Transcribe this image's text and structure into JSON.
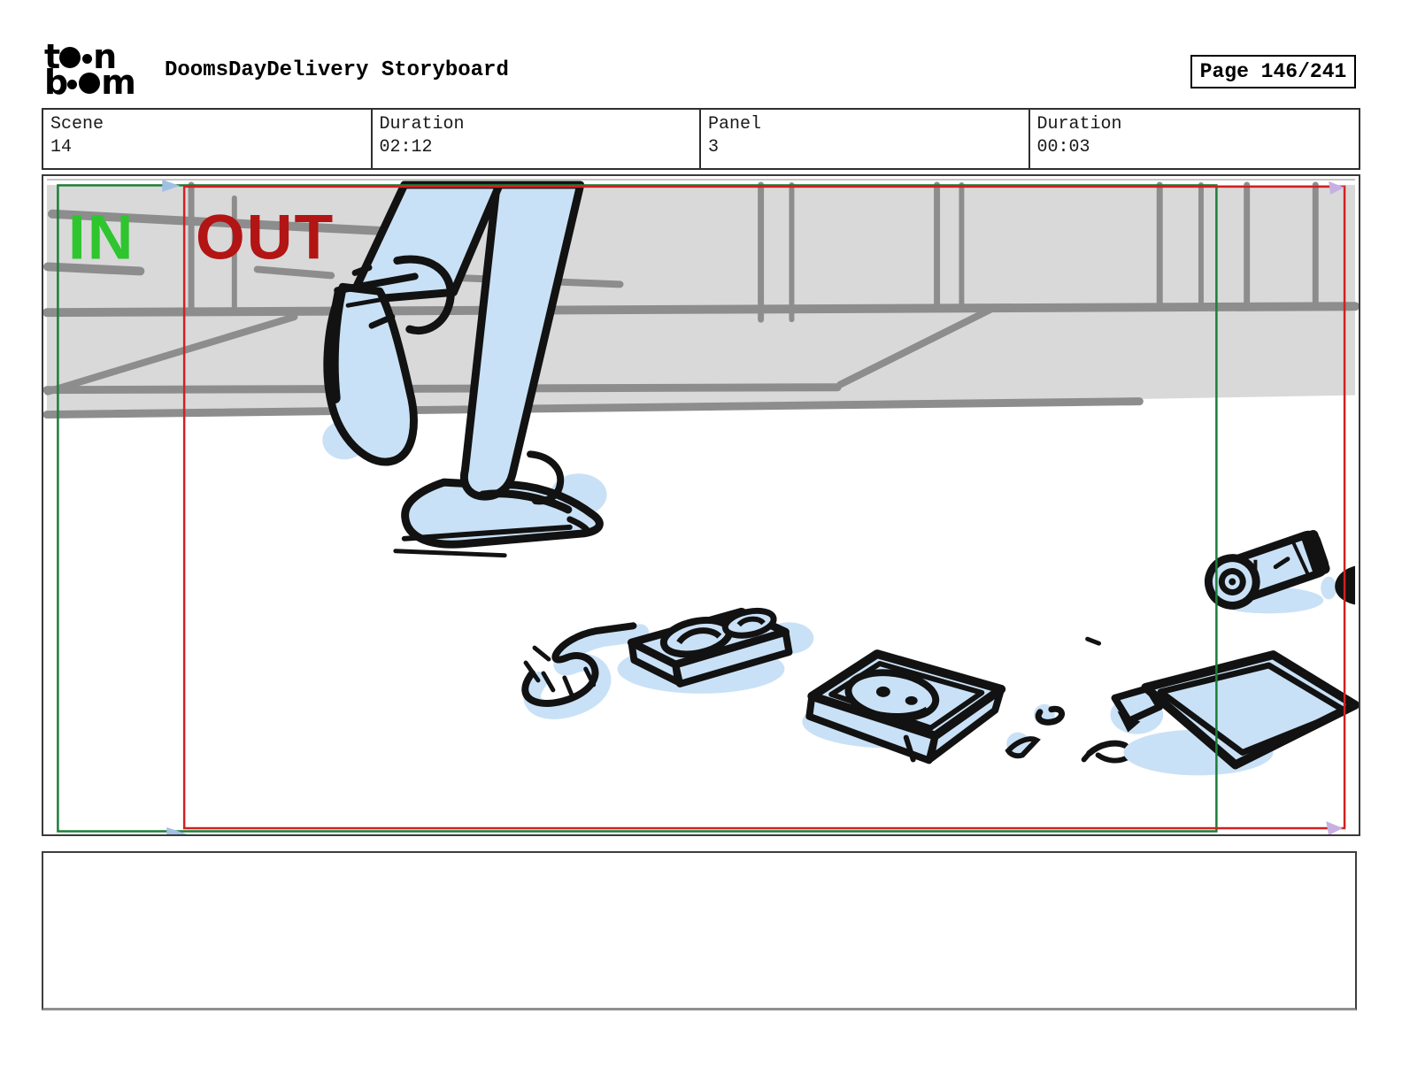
{
  "header": {
    "brand": {
      "alt": "toon boom",
      "row1_left": "t",
      "row1_right": "n",
      "row2_left": "b",
      "row2_right": "m"
    },
    "title": "DoomsDayDelivery Storyboard",
    "page_label": "Page 146/241"
  },
  "info": {
    "cells": [
      {
        "label": "Scene",
        "value": "14"
      },
      {
        "label": "Duration",
        "value": "02:12"
      },
      {
        "label": "Panel",
        "value": "3"
      },
      {
        "label": "Duration",
        "value": "00:03"
      }
    ]
  },
  "panel": {
    "in_label": "IN",
    "out_label": "OUT",
    "colors": {
      "in_text": "#2fc52f",
      "out_text": "#b31414",
      "in_frame": "#1c7e38",
      "out_frame": "#cf2121",
      "wall_gray": "#d9d9d9",
      "sketch_gray": "#8d8d8d",
      "drawing_fill_blue": "#c9e1f6",
      "ink_black": "#121212",
      "camera_arrow_blue": "#9fc0e4",
      "camera_arrow_purple": "#c6b0e2"
    }
  },
  "caption": {
    "text": ""
  }
}
